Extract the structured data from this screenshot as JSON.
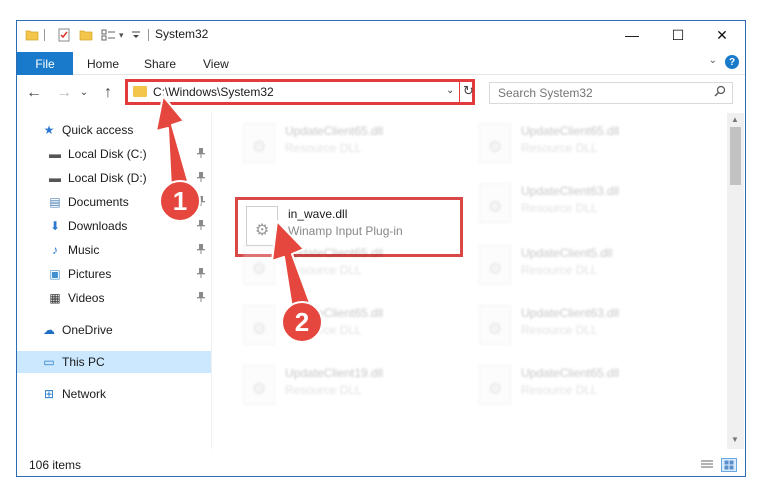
{
  "window": {
    "title": "System32",
    "controls": {
      "minimize": "—",
      "maximize": "☐",
      "close": "✕"
    }
  },
  "quick_access_toolbar": {
    "dropdown": "▾"
  },
  "ribbon": {
    "tabs": [
      "File",
      "Home",
      "Share",
      "View"
    ],
    "collapse_glyph": "⌄",
    "help_glyph": "?"
  },
  "nav": {
    "back": "←",
    "forward": "→",
    "recent": "⌄",
    "up": "↑",
    "address": "C:\\Windows\\System32",
    "address_dropdown": "⌄",
    "refresh": "↻",
    "search_placeholder": "Search System32",
    "search_icon": "⚲"
  },
  "sidebar": {
    "items": [
      {
        "label": "Quick access",
        "icon": "star-icon",
        "glyph": "★",
        "color": "#2b79d0",
        "pinned": false
      },
      {
        "label": "Local Disk (C:)",
        "icon": "drive-icon",
        "glyph": "▬",
        "color": "#555555",
        "pinned": true
      },
      {
        "label": "Local Disk (D:)",
        "icon": "drive-icon",
        "glyph": "▬",
        "color": "#555555",
        "pinned": true
      },
      {
        "label": "Documents",
        "icon": "documents-icon",
        "glyph": "▤",
        "color": "#4a7fb5",
        "pinned": true
      },
      {
        "label": "Downloads",
        "icon": "downloads-icon",
        "glyph": "⬇",
        "color": "#2b79d0",
        "pinned": true
      },
      {
        "label": "Music",
        "icon": "music-icon",
        "glyph": "♪",
        "color": "#2b79d0",
        "pinned": true
      },
      {
        "label": "Pictures",
        "icon": "pictures-icon",
        "glyph": "▣",
        "color": "#3f8fd1",
        "pinned": true
      },
      {
        "label": "Videos",
        "icon": "videos-icon",
        "glyph": "▦",
        "color": "#333333",
        "pinned": true
      },
      {
        "label": "OneDrive",
        "icon": "onedrive-icon",
        "glyph": "☁",
        "color": "#1e6fc4",
        "pinned": false
      },
      {
        "label": "This PC",
        "icon": "computer-icon",
        "glyph": "▭",
        "color": "#2a7bc9",
        "pinned": false
      },
      {
        "label": "Network",
        "icon": "network-icon",
        "glyph": "⊞",
        "color": "#2a7bc9",
        "pinned": false
      }
    ],
    "pin_glyph": "📌"
  },
  "files": [
    {
      "name": "UpdateClient65.dll",
      "desc": "Resource DLL",
      "highlighted": false
    },
    {
      "name": "UpdateClient65.dll",
      "desc": "Resource DLL",
      "highlighted": false
    },
    {
      "name": "in_wave.dll",
      "desc": "Winamp Input Plug-in",
      "highlighted": true
    },
    {
      "name": "UpdateClient63.dll",
      "desc": "Resource DLL",
      "highlighted": false
    },
    {
      "name": "UpdateClient65.dll",
      "desc": "Resource DLL",
      "highlighted": false
    },
    {
      "name": "UpdateClient5.dll",
      "desc": "Resource DLL",
      "highlighted": false
    },
    {
      "name": "UpdateClient65.dll",
      "desc": "Resource DLL",
      "highlighted": false
    },
    {
      "name": "UpdateClient63.dll",
      "desc": "Resource DLL",
      "highlighted": false
    },
    {
      "name": "UpdateClient19.dll",
      "desc": "Resource DLL",
      "highlighted": false
    },
    {
      "name": "UpdateClient65.dll",
      "desc": "Resource DLL",
      "highlighted": false
    }
  ],
  "status": {
    "item_count": "106 items"
  },
  "annotations": {
    "steps": [
      "1",
      "2"
    ],
    "color": "#e5473e"
  },
  "scrollbar": {
    "up": "▲",
    "down": "▼"
  }
}
